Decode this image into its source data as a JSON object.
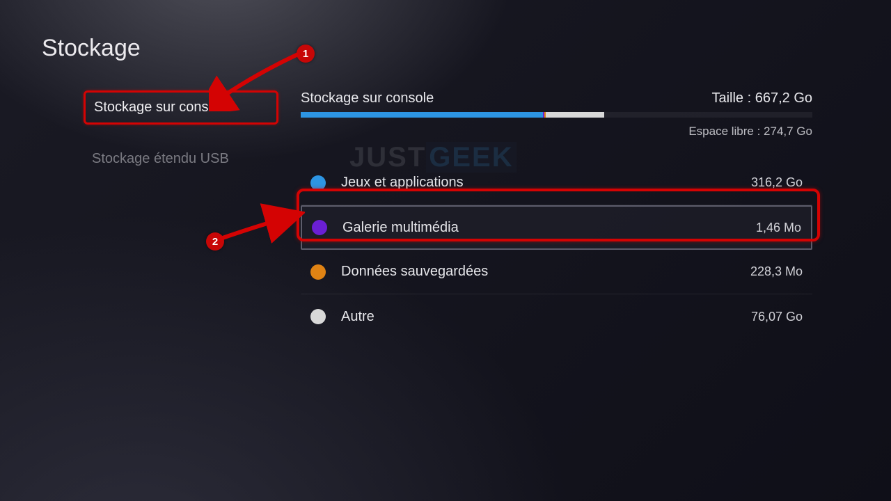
{
  "page": {
    "title": "Stockage"
  },
  "sidebar": {
    "items": [
      {
        "label": "Stockage sur console",
        "active": true
      },
      {
        "label": "Stockage étendu USB",
        "active": false
      }
    ]
  },
  "storage": {
    "heading": "Stockage sur console",
    "size_label": "Taille : 667,2 Go",
    "free_label": "Espace libre : 274,7 Go",
    "bar": [
      {
        "color": "#2d95e3",
        "width_pct": 47.4
      },
      {
        "color": "#6a1fd4",
        "width_pct": 0.2
      },
      {
        "color": "#e08314",
        "width_pct": 0.3
      },
      {
        "color": "#d8d8d8",
        "width_pct": 11.4
      }
    ],
    "categories": [
      {
        "label": "Jeux et applications",
        "size": "316,2 Go",
        "color": "#2d95e3",
        "selected": false
      },
      {
        "label": "Galerie multimédia",
        "size": "1,46 Mo",
        "color": "#6a1fd4",
        "selected": true
      },
      {
        "label": "Données sauvegardées",
        "size": "228,3 Mo",
        "color": "#e08314",
        "selected": false
      },
      {
        "label": "Autre",
        "size": "76,07 Go",
        "color": "#d8d8d8",
        "selected": false
      }
    ]
  },
  "watermark": {
    "part1": "JUST",
    "part2": "GEEK"
  },
  "annotations": {
    "badge1": "1",
    "badge2": "2"
  }
}
